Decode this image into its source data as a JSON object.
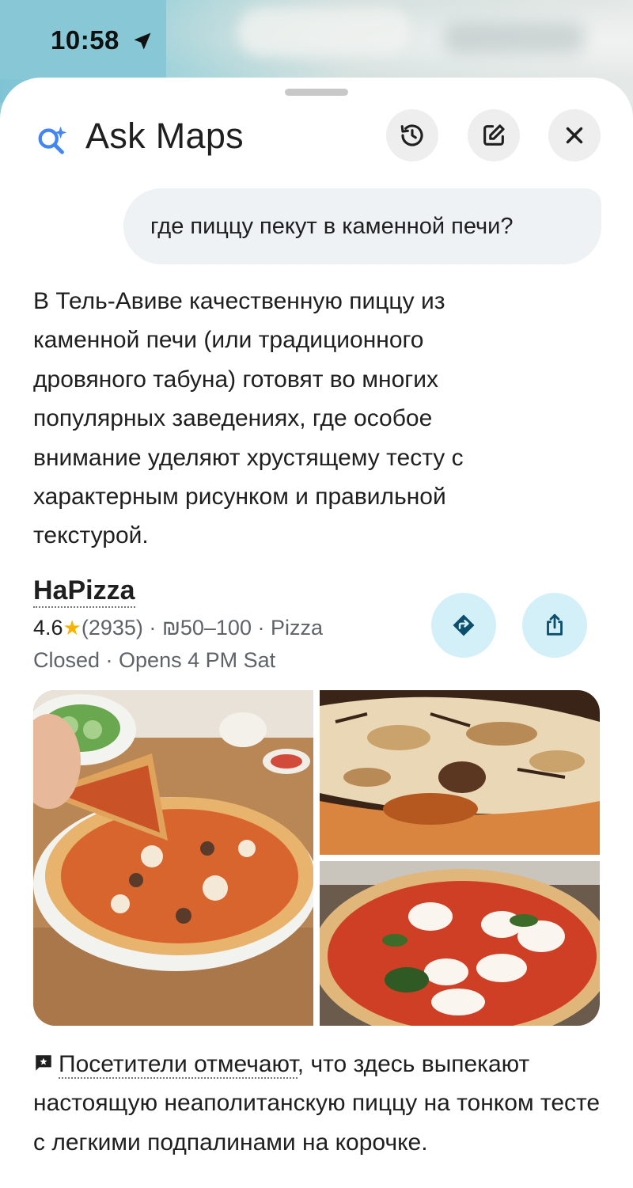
{
  "status_bar": {
    "time": "10:58",
    "location_icon": "location-arrow-icon"
  },
  "header": {
    "title": "Ask Maps",
    "icon": "sparkle-search-icon",
    "buttons": [
      {
        "name": "history-button",
        "icon": "history-icon"
      },
      {
        "name": "edit-button",
        "icon": "edit-icon"
      },
      {
        "name": "close-button",
        "icon": "close-icon"
      }
    ]
  },
  "query": {
    "text": "где пиццу пекут в каменной печи?"
  },
  "answer": {
    "text": "В Тель-Авиве качественную пиццу из каменной печи (или традиционного дровяного табуна) готовят во многих популярных заведениях, где особое внимание уделяют хрустящему тесту с характерным рисунком и правильной текстурой."
  },
  "place": {
    "name": "HaPizza",
    "rating": "4.6",
    "reviews": "(2935)",
    "price": "₪50–100",
    "category": "Pizza",
    "hours": "Closed · Opens 4 PM Sat",
    "separator": "·",
    "actions": [
      {
        "name": "directions-button",
        "icon": "directions-icon"
      },
      {
        "name": "share-button",
        "icon": "share-icon"
      }
    ],
    "photos": [
      "pizza-photo-sliced",
      "pizza-photo-mushroom",
      "pizza-photo-margherita"
    ]
  },
  "review": {
    "link_text": "Посетители отмечают",
    "text": ", что здесь выпекают настоящую неаполитанскую пиццу на тонком тесте с легкими подпалинами на корочке.",
    "icon": "review-star-icon"
  }
}
